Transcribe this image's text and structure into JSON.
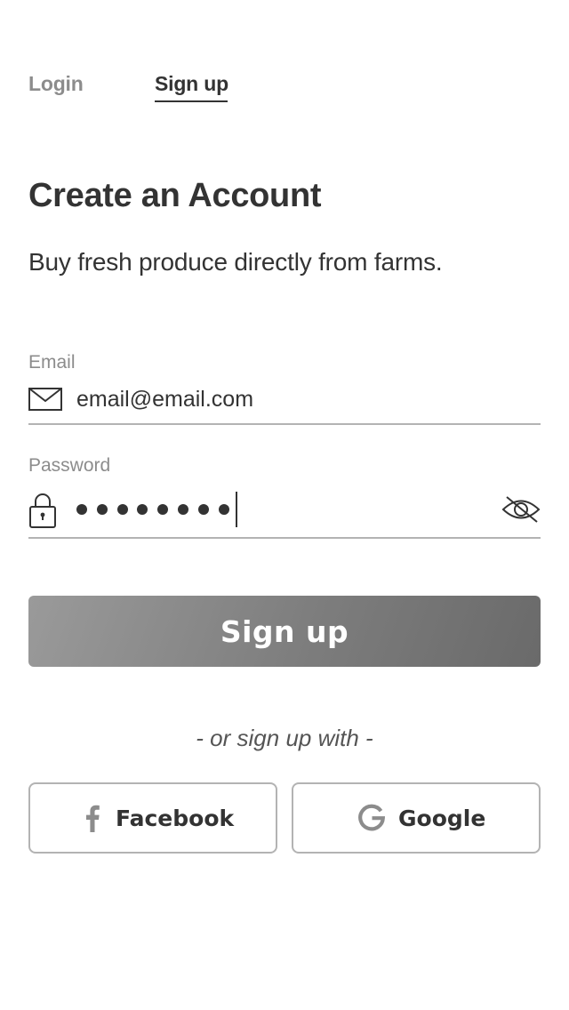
{
  "tabs": {
    "login_label": "Login",
    "signup_label": "Sign up",
    "active": "signup"
  },
  "header": {
    "title": "Create an Account",
    "subtitle": "Buy fresh produce directly from farms."
  },
  "form": {
    "email": {
      "label": "Email",
      "value": "email@email.com",
      "icon": "mail-icon"
    },
    "password": {
      "label": "Password",
      "masked_length": 8,
      "icon": "lock-icon",
      "toggle_icon": "eye-slash-icon"
    },
    "submit_label": "Sign up"
  },
  "social": {
    "divider": "- or sign up with -",
    "facebook_label": "Facebook",
    "google_label": "Google"
  },
  "colors": {
    "text": "#333333",
    "muted": "#8c8c8c",
    "border": "#b3b3b3",
    "button_gradient_start": "#9a9a9a",
    "button_gradient_end": "#6a6a6a"
  }
}
